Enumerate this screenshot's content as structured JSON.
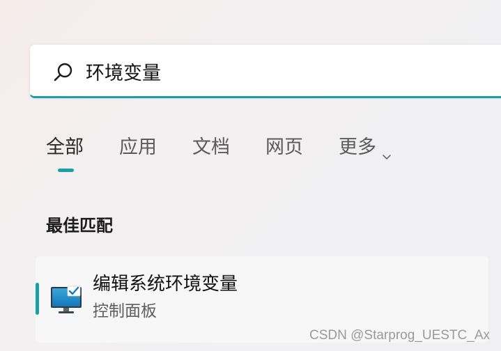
{
  "search": {
    "value": "环境变量",
    "icon": "search-icon",
    "accent_color": "#1a9faa"
  },
  "tabs": [
    {
      "label": "全部",
      "active": true
    },
    {
      "label": "应用",
      "active": false
    },
    {
      "label": "文档",
      "active": false
    },
    {
      "label": "网页",
      "active": false
    },
    {
      "label": "更多",
      "active": false,
      "icon": "chevron-down-icon"
    }
  ],
  "best_match": {
    "heading": "最佳匹配",
    "result": {
      "title": "编辑系统环境变量",
      "subtitle": "控制面板",
      "icon": "control-panel-monitor-icon"
    }
  },
  "watermark": "CSDN @Starprog_UESTC_Ax"
}
